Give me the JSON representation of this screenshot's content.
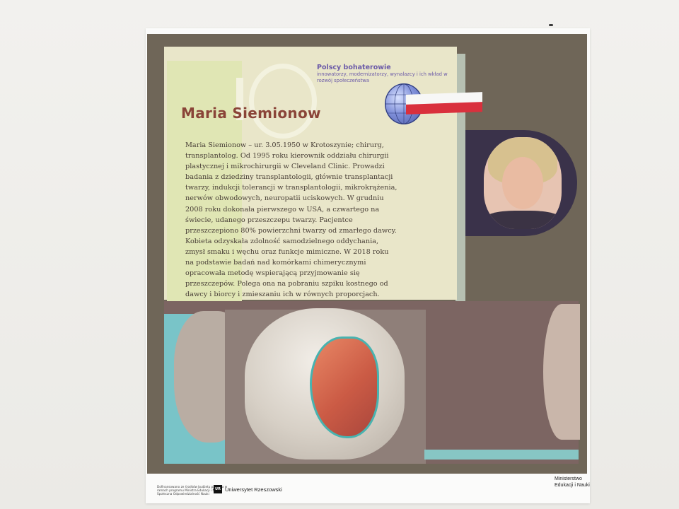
{
  "poster": {
    "series_title": "Polscy bohaterowie",
    "series_subtitle": "innowatorzy, modernizatorzy, wynalazcy i ich wkład w rozwój społeczeństwa",
    "name": "Maria Siemionow",
    "bio": "Maria Siemionow – ur. 3.05.1950 w Krotoszynie; chirurg, transplantolog. Od 1995 roku kierownik oddziału chirurgii plastycznej i mikrochirurgii w Cleveland Clinic. Prowadzi badania z dziedziny transplantologii, głównie transplantacji twarzy, indukcji tolerancji w transplantologii, mikrokrążenia, nerwów obwodowych, neuropatii uciskowych. W grudniu 2008 roku dokonała pierwszego w USA, a czwartego na świecie, udanego przeszczepu twarzy. Pacjentce przeszczepiono 80% powierzchni twarzy od zmarłego dawcy. Kobieta odzyskała zdolność samodzielnego oddychania, zmysł smaku i węchu oraz funkcje mimiczne. W 2018 roku na podstawie badań nad komórkami chimerycznymi opracowała metodę wspierającą przyjmowanie się przeszczepów. Polega ona na pobraniu szpiku kostnego od dawcy i biorcy i zmieszaniu ich w równych proporcjach."
  },
  "footer": {
    "funding_note": "Dofinansowano ze środków budżetu państwa w ramach programu Ministra Edukacji i Nauki Społeczna Odpowiedzialność Nauki",
    "university_logo": "UR",
    "university_name": "Uniwersytet Rzeszowski",
    "ministry_name": "Ministerstwo Edukacji i Nauki"
  },
  "colors": {
    "frame": "#6f6658",
    "panel": "#e9e6c9",
    "accent_purple": "#6b5aa8",
    "name_red": "#8a4438",
    "flag_red": "#d9303d"
  },
  "icons": [
    "globe-icon",
    "polish-flag-icon"
  ]
}
